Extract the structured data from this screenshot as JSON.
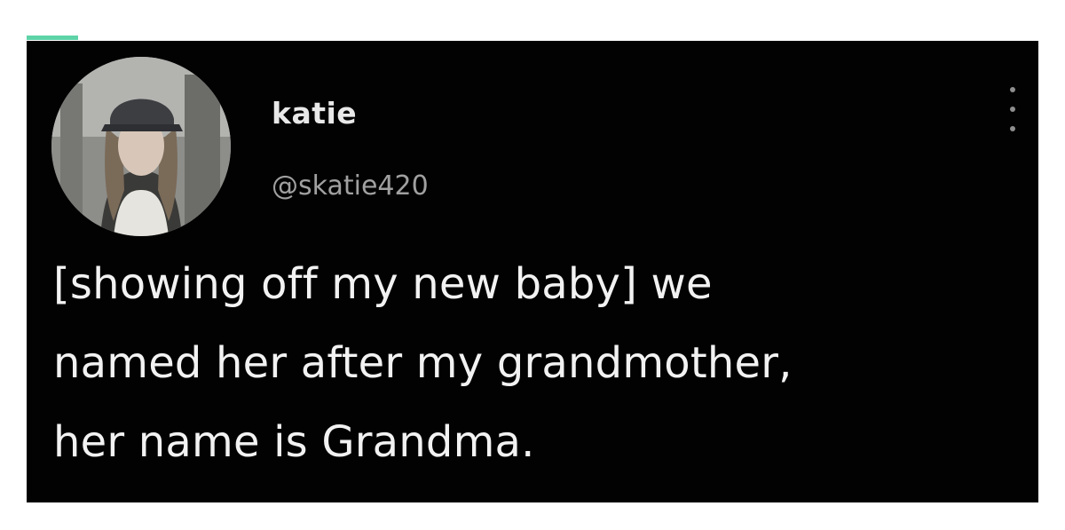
{
  "accent_color": "#5fd3a8",
  "card": {
    "background": "#020202"
  },
  "author": {
    "display_name": "katie",
    "handle": "@skatie420",
    "avatar_icon": "user-avatar-photo"
  },
  "menu": {
    "icon": "more-vertical-icon"
  },
  "tweet": {
    "text": "[showing off my new baby] we\nnamed her after my grandmother,\nher name is Grandma."
  }
}
